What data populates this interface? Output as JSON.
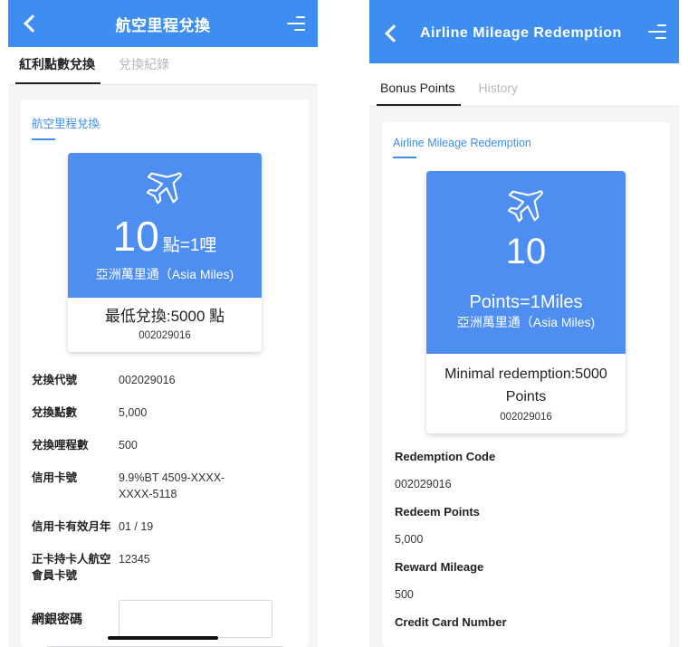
{
  "zh": {
    "header_title": "航空里程兌換",
    "tabs": [
      {
        "label": "紅利點數兌換",
        "active": true
      },
      {
        "label": "兌換紀錄",
        "active": false
      }
    ],
    "section_title": "航空里程兌換",
    "promo": {
      "rate_number": "10",
      "rate_unit": "點=1哩",
      "program": "亞洲萬里通（Asia Miles)",
      "minimum": "最低兌換:5000 點",
      "code": "002029016"
    },
    "details": [
      {
        "label": "兌換代號",
        "value": "002029016"
      },
      {
        "label": "兌換點數",
        "value": "5,000"
      },
      {
        "label": "兌換哩程數",
        "value": "500"
      },
      {
        "label": "信用卡號",
        "value": "9.9%BT 4509-XXXX-XXXX-5118"
      },
      {
        "label": "信用卡有效月年",
        "value": "01 / 19"
      },
      {
        "label": "正卡持卡人航空會員卡號",
        "value": "12345"
      }
    ],
    "password_label": "網銀密碼"
  },
  "en": {
    "header_title": "Airline Mileage Redemption",
    "tabs": [
      {
        "label": "Bonus Points",
        "active": true
      },
      {
        "label": "History",
        "active": false
      }
    ],
    "section_title": "Airline Mileage Redemption",
    "promo": {
      "rate_number": "10",
      "rate_unit": "Points=1Miles",
      "program": "亞洲萬里通（Asia Miles)",
      "minimum": "Minimal redemption:5000 Points",
      "code": "002029016"
    },
    "details": [
      {
        "label": "Redemption Code",
        "value": "002029016"
      },
      {
        "label": "Redeem Points",
        "value": "5,000"
      },
      {
        "label": "Reward Mileage",
        "value": "500"
      },
      {
        "label": "Credit Card Number",
        "value": ""
      }
    ]
  },
  "colors": {
    "brand_blue": "#3d8ef0",
    "promo_blue": "#4d8ef0"
  },
  "icons": {
    "back": "chevron-left-icon",
    "menu": "menu-icon",
    "plane": "airplane-icon"
  }
}
